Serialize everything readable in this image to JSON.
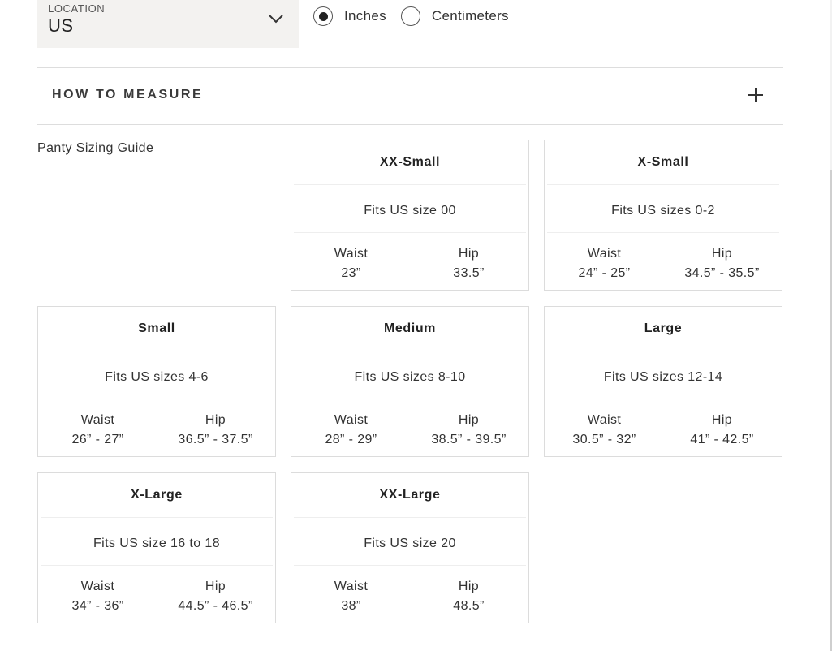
{
  "location": {
    "label": "LOCATION",
    "value": "US"
  },
  "units": {
    "options": [
      {
        "label": "Inches",
        "selected": true
      },
      {
        "label": "Centimeters",
        "selected": false
      }
    ]
  },
  "how_to_measure": {
    "title": "HOW TO MEASURE"
  },
  "guide": {
    "title": "Panty Sizing Guide",
    "waist_label": "Waist",
    "hip_label": "Hip",
    "sizes": [
      {
        "name": "XX-Small",
        "fits": "Fits US size 00",
        "waist": "23”",
        "hip": "33.5”"
      },
      {
        "name": "X-Small",
        "fits": "Fits US sizes 0-2",
        "waist": "24” - 25”",
        "hip": "34.5” - 35.5”"
      },
      {
        "name": "Small",
        "fits": "Fits US sizes 4-6",
        "waist": "26” - 27”",
        "hip": "36.5” - 37.5”"
      },
      {
        "name": "Medium",
        "fits": "Fits US sizes 8-10",
        "waist": "28” - 29”",
        "hip": "38.5” - 39.5”"
      },
      {
        "name": "Large",
        "fits": "Fits US sizes 12-14",
        "waist": "30.5” - 32”",
        "hip": "41” - 42.5”"
      },
      {
        "name": "X-Large",
        "fits": "Fits US size 16 to 18",
        "waist": "34” - 36”",
        "hip": "44.5” - 46.5”"
      },
      {
        "name": "XX-Large",
        "fits": "Fits US size 20",
        "waist": "38”",
        "hip": "48.5”"
      }
    ]
  }
}
